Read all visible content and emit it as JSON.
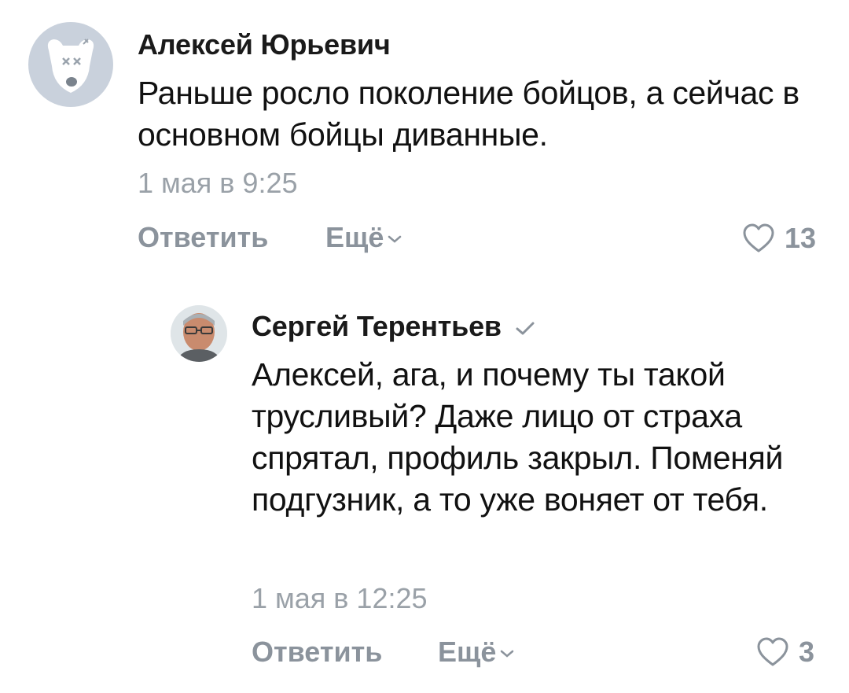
{
  "comments": [
    {
      "author": "Алексей Юрьевич",
      "text": "Раньше росло поколение бойцов, а сейчас в основном бойцы диванные.",
      "date": "1 мая в 9:25",
      "reply_label": "Ответить",
      "more_label": "Ещё",
      "likes": "13",
      "avatar_icon": "deactivated-dog-avatar-icon"
    },
    {
      "author": "Сергей Терентьев",
      "text": "Алексей, ага, и почему ты такой трусливый? Даже лицо от страха спрятал, профиль закрыл. Поменяй подгузник, а то уже воняет от тебя.",
      "date": "1 мая в 12:25",
      "reply_label": "Ответить",
      "more_label": "Ещё",
      "likes": "3",
      "verified_icon": "verified-check-icon"
    }
  ],
  "colors": {
    "muted": "#8b939c",
    "date": "#9aa1a8",
    "avatar_bg": "#c9d1dc"
  }
}
